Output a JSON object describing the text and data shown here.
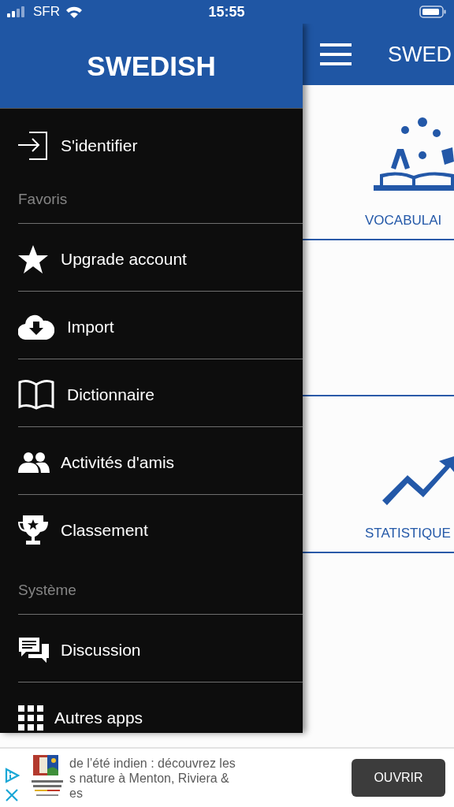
{
  "status_bar": {
    "carrier": "SFR",
    "time": "15:55"
  },
  "drawer": {
    "title": "SWEDISH",
    "entries": [
      {
        "kind": "item",
        "label": "S'identifier"
      },
      {
        "kind": "section",
        "label": "Favoris"
      },
      {
        "kind": "item",
        "label": "Upgrade account"
      },
      {
        "kind": "item",
        "label": "Import"
      },
      {
        "kind": "item",
        "label": "Dictionnaire"
      },
      {
        "kind": "item",
        "label": "Activités d'amis"
      },
      {
        "kind": "item",
        "label": "Classement"
      },
      {
        "kind": "section",
        "label": "Système"
      },
      {
        "kind": "item",
        "label": "Discussion"
      },
      {
        "kind": "item",
        "label": "Autres apps"
      }
    ]
  },
  "app_bar": {
    "title": "SWED"
  },
  "tiles": [
    {
      "kind": "vocabulary",
      "label": "VOCABULAI"
    },
    {
      "kind": "empty"
    },
    {
      "kind": "statistics",
      "label": "STATISTIQUE"
    }
  ],
  "ad": {
    "lines": [
      "de l’été indien : découvrez les",
      "s nature à Menton, Riviera &",
      "es"
    ],
    "button": "OUVRIR"
  }
}
